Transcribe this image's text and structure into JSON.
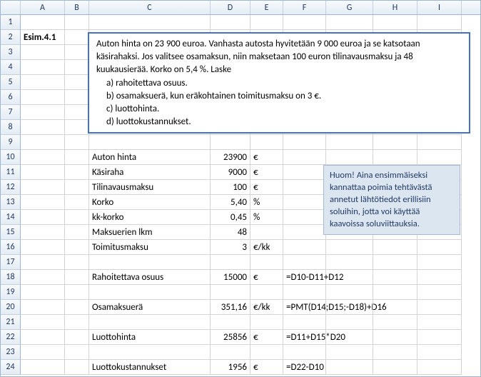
{
  "columns": [
    "A",
    "B",
    "C",
    "D",
    "E",
    "F",
    "G",
    "H",
    "I"
  ],
  "col_widths": [
    "wA",
    "wB",
    "wC",
    "wD",
    "wE",
    "wF",
    "wG",
    "wH",
    "wI"
  ],
  "row_count": 24,
  "a2": "Esim.4.1",
  "problem": {
    "intro": "Auton hinta on 23 900 euroa. Vanhasta autosta hyvitetään 9 000 euroa ja se katsotaan käsirahaksi. Jos valitsee osamaksun, niin maksetaan 100 euron tilinavausmaksu ja 48 kuukausierää. Korko on 5,4 %. Laske",
    "opts": [
      "a)   rahoitettava osuus.",
      "b)   osamaksuerä, kun eräkohtainen toimitusmaksu on 3 €.",
      "c)   luottohinta.",
      "d)   luottokustannukset."
    ]
  },
  "hint": "Huom! Aina ensimmäiseksi kannattaa poimia tehtävästä annetut lähtötiedot erillisiin soluihin, jotta voi käyttää kaavoissa soluviittauksia.",
  "labels": {
    "r10": "Auton hinta",
    "r11": "Käsiraha",
    "r12": "Tilinavausmaksu",
    "r13": "Korko",
    "r14": "kk-korko",
    "r15": "Maksuerien lkm",
    "r16": "Toimitusmaksu",
    "r18": "Rahoitettava osuus",
    "r20": "Osamaksuerä",
    "r22": "Luottohinta",
    "r24": "Luottokustannukset"
  },
  "values": {
    "r10": "23900",
    "r11": "9000",
    "r12": "100",
    "r13": "5,40",
    "r14": "0,45",
    "r15": "48",
    "r16": "3",
    "r18": "15000",
    "r20": "351,16",
    "r22": "25856",
    "r24": "1956"
  },
  "units": {
    "eur": "€",
    "pct": "%",
    "eurkk": "€/kk"
  },
  "formulas": {
    "r18": "=D10-D11+D12",
    "r20": "=PMT(D14;D15;-D18)+D16",
    "r22": "=D11+D15*D20",
    "r24": "=D22-D10"
  }
}
